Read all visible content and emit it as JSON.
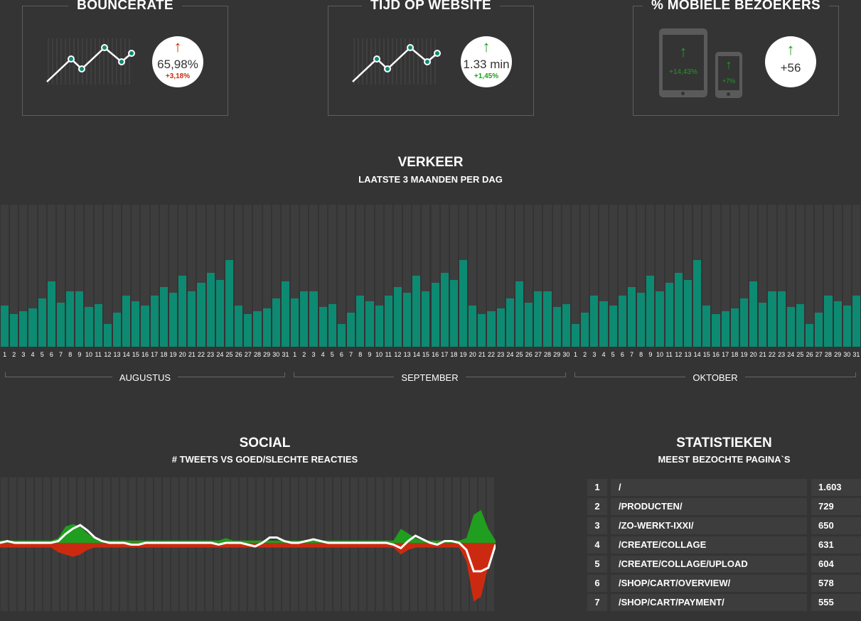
{
  "kpis": [
    {
      "title": "BOUNCERATE",
      "value": "65,98%",
      "change": "+3,18%",
      "direction": "up",
      "status": "bad"
    },
    {
      "title": "TIJD OP WEBSITE",
      "value": "1.33 min",
      "change": "+1,45%",
      "direction": "up",
      "status": "good"
    },
    {
      "title": "% MOBIELE BEZOEKERS",
      "tablet_change": "+14,43%",
      "phone_change": "+7%",
      "value": "+56",
      "direction": "up"
    }
  ],
  "colors": {
    "bad": "#cc2a10",
    "good": "#1f9e1f",
    "bar": "#0d8a72",
    "background": "#343434"
  },
  "icons": {
    "sparkline": "sparkline-icon",
    "tablet": "tablet-icon",
    "phone": "phone-icon",
    "arrow": "arrow-up-icon"
  },
  "traffic": {
    "title": "VERKEER",
    "subtitle": "LAATSTE 3 MAANDEN PER DAG",
    "months": [
      {
        "name": "AUGUSTUS",
        "days": 31
      },
      {
        "name": "SEPTEMBER",
        "days": 30
      },
      {
        "name": "OKTOBER",
        "days": 31
      }
    ]
  },
  "chart_data": {
    "type": "bar",
    "ylim": [
      0,
      100
    ],
    "values": [
      29,
      23,
      25,
      27,
      34,
      46,
      31,
      39,
      39,
      28,
      30,
      16,
      24,
      36,
      32,
      29,
      36,
      42,
      38,
      50,
      39,
      45,
      52,
      47,
      61,
      29,
      23,
      25,
      27,
      34,
      46,
      34,
      39,
      39,
      28,
      30,
      16,
      24,
      36,
      32,
      29,
      36,
      42,
      38,
      50,
      39,
      45,
      52,
      47,
      61,
      29,
      23,
      25,
      27,
      34,
      46,
      31,
      39,
      39,
      28,
      30,
      16,
      24,
      36,
      32,
      29,
      36,
      42,
      38,
      50,
      39,
      45,
      52,
      47,
      61,
      29,
      23,
      25,
      27,
      34,
      46,
      31,
      39,
      39,
      28,
      30,
      16,
      24,
      36,
      32,
      29,
      36
    ]
  },
  "social": {
    "title": "SOCIAL",
    "subtitle": "# TWEETS VS GOED/SLECHTE REACTIES",
    "good": [
      1,
      1,
      1,
      1,
      1,
      1,
      1,
      1,
      2,
      7,
      8,
      7,
      4,
      2,
      1,
      1,
      1,
      1,
      1,
      1,
      1,
      1,
      1,
      1,
      1,
      1,
      1,
      1,
      1,
      1,
      1,
      2,
      1,
      1,
      1,
      1,
      1,
      1,
      1,
      1,
      1,
      1,
      1,
      1,
      1,
      1,
      1,
      1,
      1,
      1,
      1,
      1,
      1,
      1,
      1,
      6,
      4,
      2,
      1,
      1,
      1,
      1,
      1,
      1,
      2,
      12,
      14,
      6,
      1
    ],
    "bad": [
      2,
      2,
      2,
      2,
      2,
      2,
      2,
      2,
      4,
      5,
      6,
      5,
      3,
      2,
      2,
      2,
      2,
      2,
      2,
      2,
      2,
      2,
      2,
      2,
      2,
      2,
      2,
      2,
      2,
      2,
      2,
      2,
      2,
      2,
      2,
      2,
      2,
      2,
      2,
      2,
      2,
      2,
      2,
      2,
      2,
      2,
      2,
      2,
      2,
      2,
      2,
      2,
      2,
      2,
      2,
      5,
      3,
      2,
      2,
      2,
      2,
      2,
      2,
      2,
      8,
      25,
      23,
      10,
      1
    ],
    "tweets": [
      0,
      1,
      0,
      0,
      0,
      0,
      0,
      0,
      1,
      5,
      8,
      10,
      7,
      3,
      1,
      0,
      0,
      0,
      -1,
      -1,
      0,
      0,
      0,
      0,
      0,
      0,
      0,
      0,
      0,
      0,
      -1,
      0,
      0,
      0,
      -1,
      -2,
      0,
      3,
      3,
      1,
      0,
      0,
      1,
      2,
      1,
      0,
      0,
      0,
      0,
      0,
      0,
      0,
      0,
      0,
      -1,
      -3,
      1,
      4,
      2,
      0,
      -1,
      1,
      1,
      0,
      -4,
      -16,
      -16,
      -14,
      -1
    ]
  },
  "stats": {
    "title": "STATISTIEKEN",
    "subtitle": "MEEST BEZOCHTE PAGINA`S",
    "rows": [
      {
        "rank": "1",
        "page": "/",
        "visits": "1.603"
      },
      {
        "rank": "2",
        "page": "/PRODUCTEN/",
        "visits": "729"
      },
      {
        "rank": "3",
        "page": "/ZO-WERKT-IXXI/",
        "visits": "650"
      },
      {
        "rank": "4",
        "page": "/CREATE/COLLAGE",
        "visits": "631"
      },
      {
        "rank": "5",
        "page": "/CREATE/COLLAGE/UPLOAD",
        "visits": "604"
      },
      {
        "rank": "6",
        "page": "/SHOP/CART/OVERVIEW/",
        "visits": "578"
      },
      {
        "rank": "7",
        "page": "/SHOP/CART/PAYMENT/",
        "visits": "555"
      }
    ]
  }
}
